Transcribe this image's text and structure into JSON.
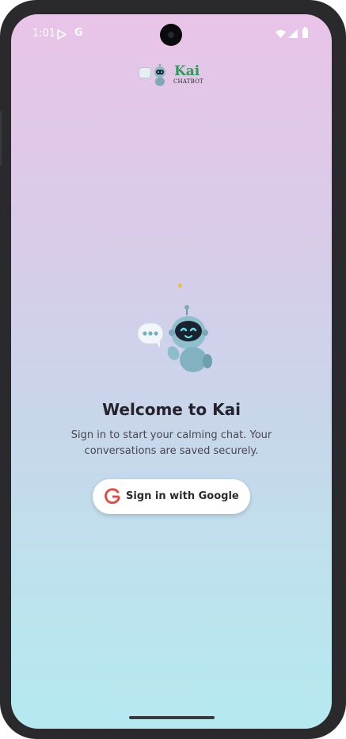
{
  "status_bar": {
    "time": "1:01",
    "icons": [
      "play-store-icon",
      "google-icon",
      "wifi-icon",
      "signal-icon",
      "battery-icon"
    ],
    "google_glyph": "G"
  },
  "logo": {
    "brand": "Kai",
    "subtitle": "CHATBOT",
    "brand_color": "#2e9a57"
  },
  "welcome": {
    "title": "Welcome to Kai",
    "subtitle": "Sign in to start your calming chat. Your conversations are saved securely."
  },
  "sign_in": {
    "label": "Sign in with Google",
    "icon": "google-g-icon"
  },
  "colors": {
    "gradient_top": "#e8c4e8",
    "gradient_bottom": "#b5e9f1",
    "accent_dot": "#e8c22a",
    "text_primary": "#25222b"
  }
}
